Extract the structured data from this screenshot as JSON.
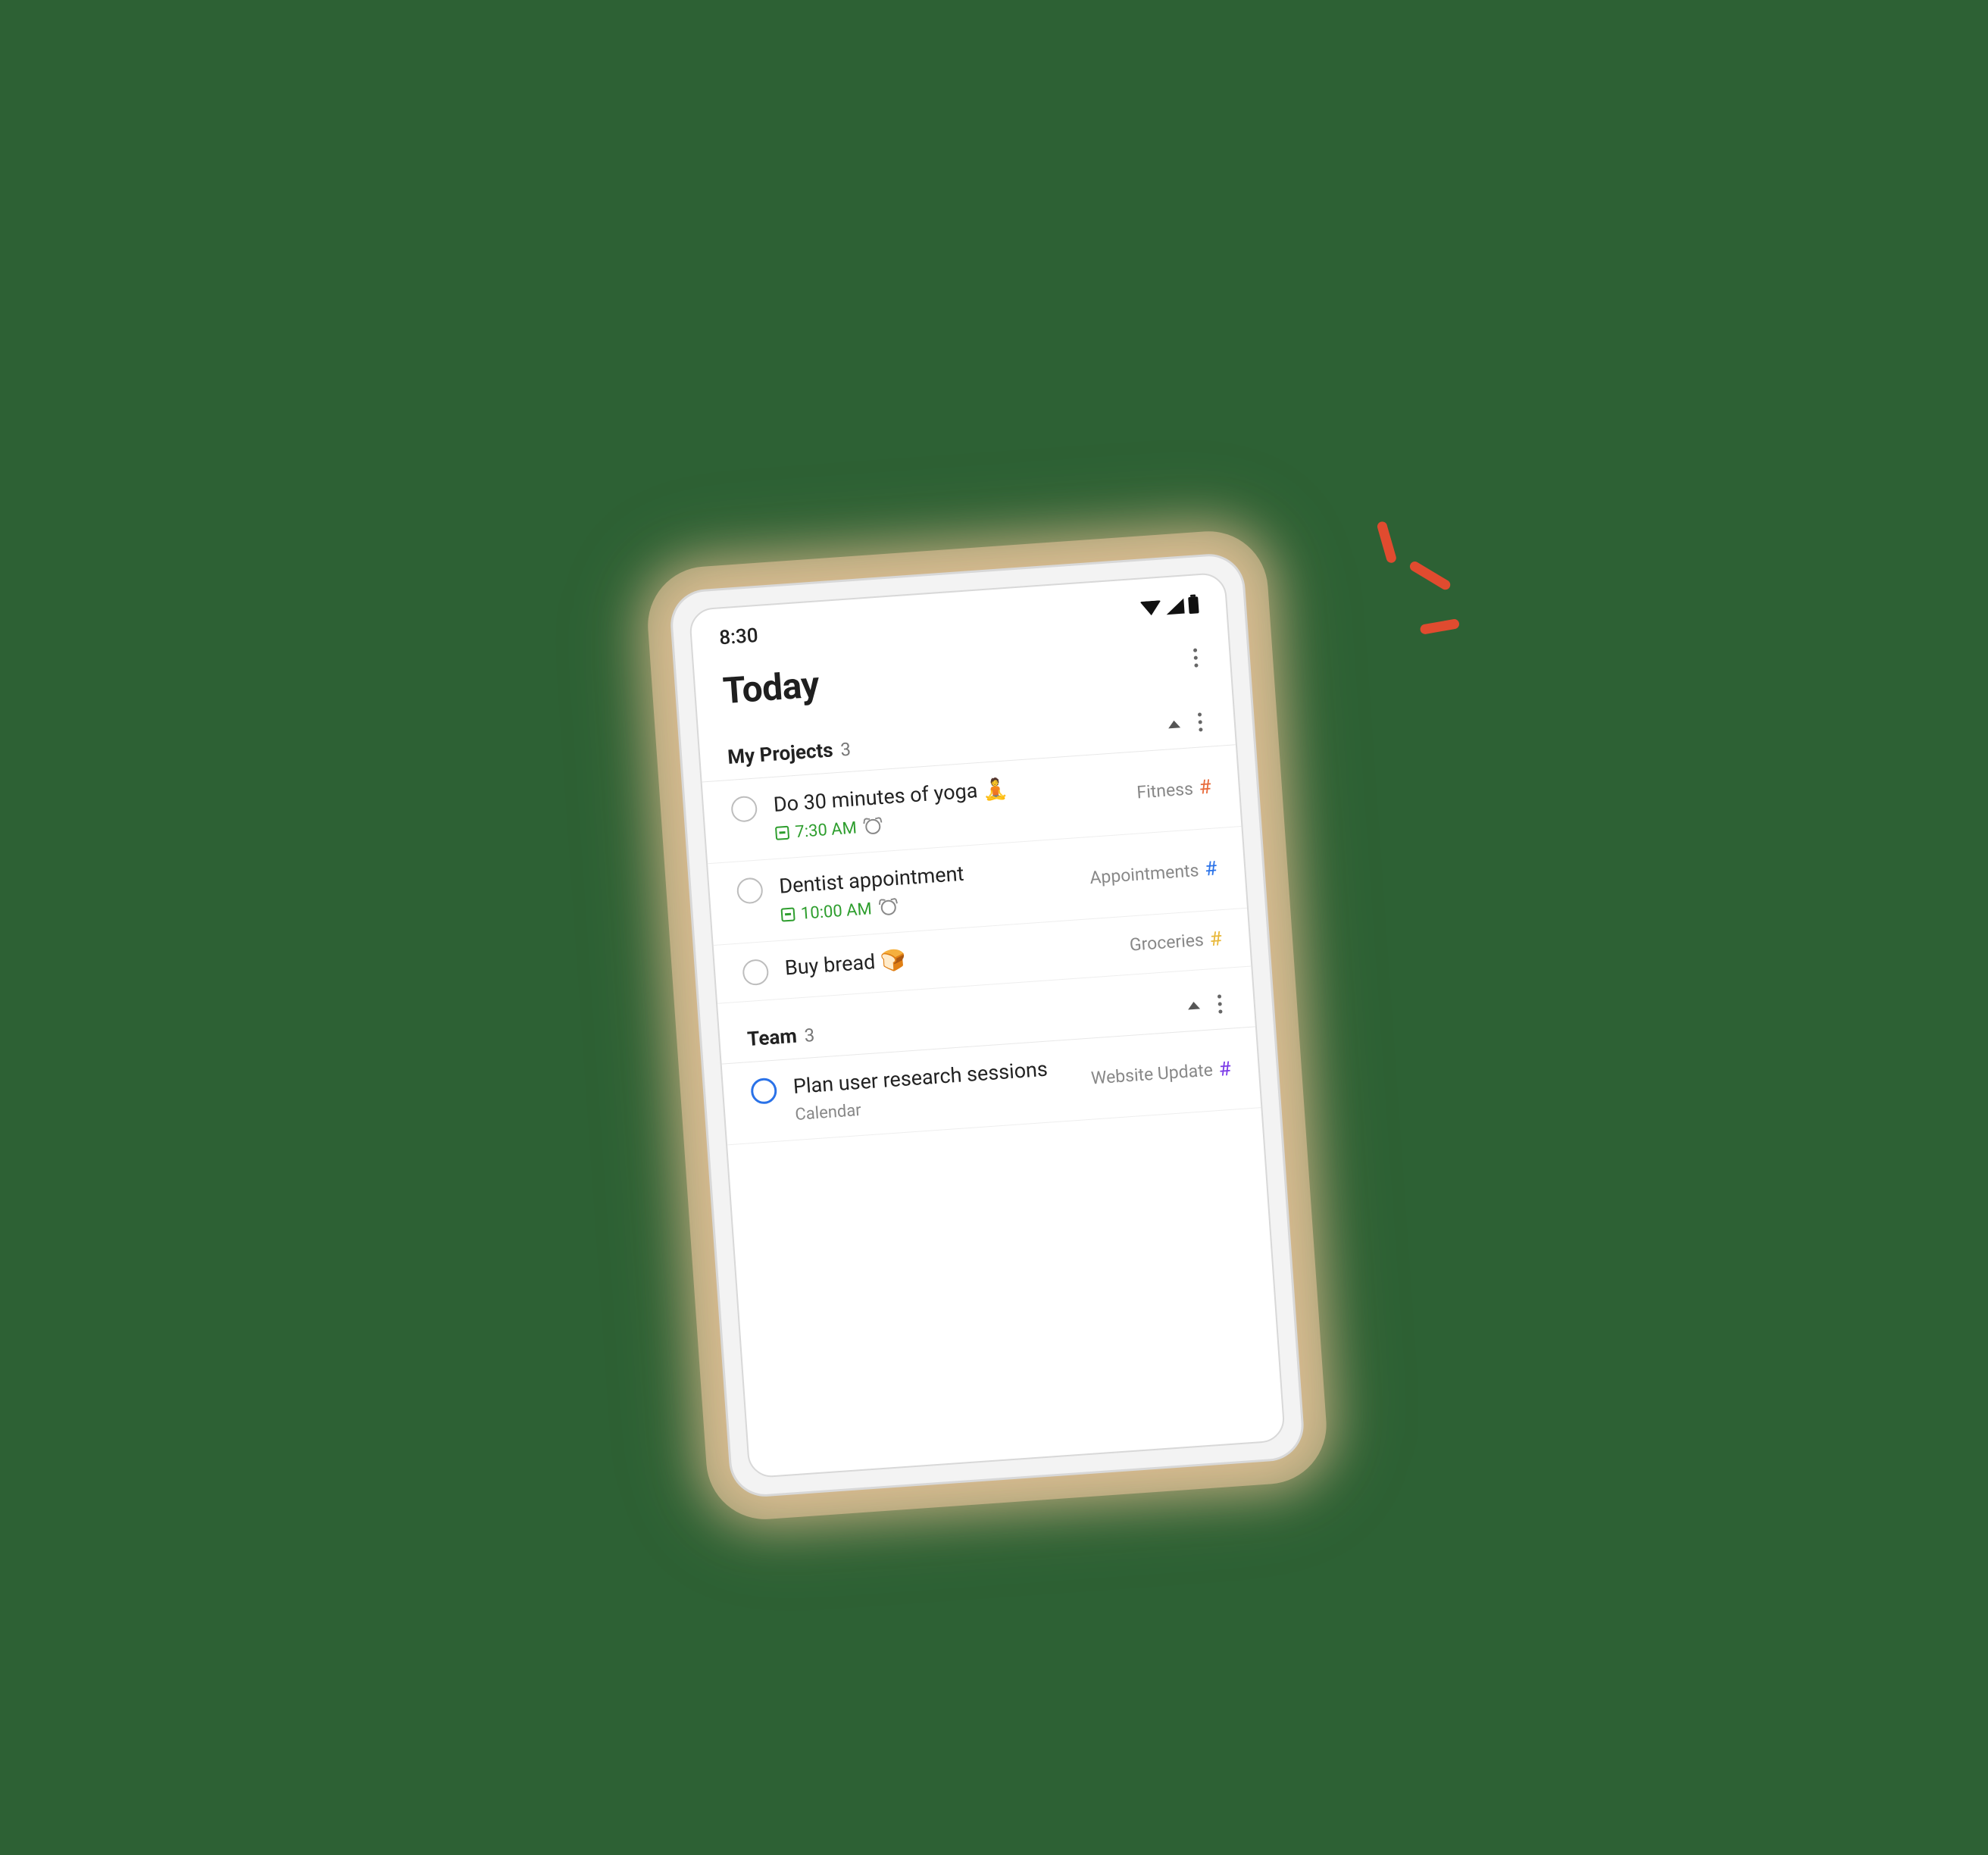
{
  "status": {
    "time": "8:30"
  },
  "header": {
    "title": "Today"
  },
  "sections": [
    {
      "title": "My Projects",
      "count": "3",
      "tasks": [
        {
          "title": "Do 30 minutes of yoga 🧘",
          "time": "7:30 AM",
          "has_alarm": true,
          "tag": "Fitness",
          "tag_color": "orange",
          "circle": "grey"
        },
        {
          "title": "Dentist appointment",
          "time": "10:00 AM",
          "has_alarm": true,
          "tag": "Appointments",
          "tag_color": "blue",
          "circle": "grey"
        },
        {
          "title": "Buy bread 🍞",
          "time": "",
          "has_alarm": false,
          "tag": "Groceries",
          "tag_color": "yellow",
          "circle": "grey"
        }
      ]
    },
    {
      "title": "Team",
      "count": "3",
      "tasks": [
        {
          "title": "Plan user research sessions",
          "time": "",
          "has_alarm": false,
          "extra_meta": "Calendar",
          "tag": "Website Update",
          "tag_color": "purple",
          "circle": "blue"
        }
      ]
    }
  ]
}
